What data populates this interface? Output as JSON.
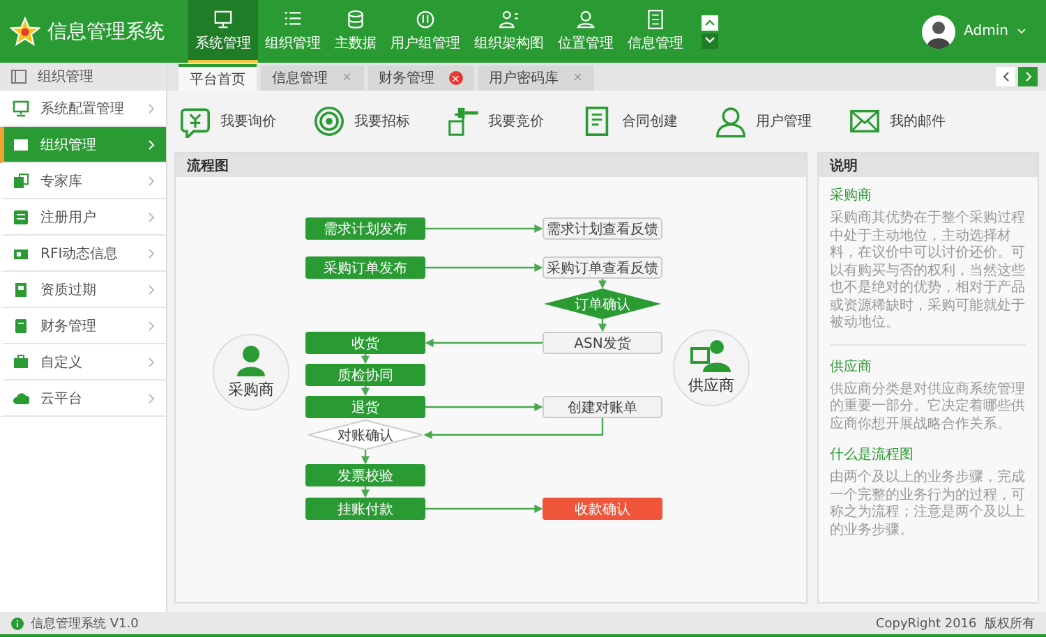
{
  "app": {
    "title": "信息管理系统"
  },
  "top_nav": [
    {
      "label": "系统管理",
      "selected": true
    },
    {
      "label": "组织管理",
      "selected": false
    },
    {
      "label": "主数据",
      "selected": false
    },
    {
      "label": "用户组管理",
      "selected": false
    },
    {
      "label": "组织架构图",
      "selected": false
    },
    {
      "label": "位置管理",
      "selected": false
    },
    {
      "label": "信息管理",
      "selected": false
    }
  ],
  "user": {
    "name": "Admin"
  },
  "sidebar": {
    "title": "组织管理",
    "items": [
      {
        "label": "系统配置管理",
        "selected": false
      },
      {
        "label": "组织管理",
        "selected": true
      },
      {
        "label": "专家库",
        "selected": false
      },
      {
        "label": "注册用户",
        "selected": false
      },
      {
        "label": "RFI动态信息",
        "selected": false
      },
      {
        "label": "资质过期",
        "selected": false
      },
      {
        "label": "财务管理",
        "selected": false
      },
      {
        "label": "自定义",
        "selected": false
      },
      {
        "label": "云平台",
        "selected": false
      }
    ]
  },
  "tabs": [
    {
      "label": "平台首页",
      "selected": true
    },
    {
      "label": "信息管理",
      "selected": false,
      "close": "×",
      "close_hover": false
    },
    {
      "label": "财务管理",
      "selected": false,
      "close": "×",
      "close_hover": true
    },
    {
      "label": "用户密码库",
      "selected": false,
      "close": "×",
      "close_hover": false
    }
  ],
  "shortcuts": [
    {
      "label": "我要询价"
    },
    {
      "label": "我要招标"
    },
    {
      "label": "我要竞价"
    },
    {
      "label": "合同创建"
    },
    {
      "label": "用户管理"
    },
    {
      "label": "我的邮件"
    }
  ],
  "flowchart": {
    "title": "流程图",
    "actors": [
      {
        "label": "采购商"
      },
      {
        "label": "供应商"
      }
    ],
    "nodes": [
      {
        "text": "需求计划发布",
        "kind": "step"
      },
      {
        "text": "需求计划查看反馈",
        "kind": "note"
      },
      {
        "text": "采购订单发布",
        "kind": "step"
      },
      {
        "text": "采购订单查看反馈",
        "kind": "note"
      },
      {
        "text": "订单确认",
        "kind": "decision"
      },
      {
        "text": "收货",
        "kind": "step"
      },
      {
        "text": "ASN发货",
        "kind": "note"
      },
      {
        "text": "质检协同",
        "kind": "step"
      },
      {
        "text": "退货",
        "kind": "step"
      },
      {
        "text": "创建对账单",
        "kind": "note"
      },
      {
        "text": "对账确认",
        "kind": "check"
      },
      {
        "text": "发票校验",
        "kind": "step"
      },
      {
        "text": "挂账付款",
        "kind": "step"
      },
      {
        "text": "收款确认",
        "kind": "alert"
      }
    ]
  },
  "info": {
    "title": "说明",
    "sections": [
      {
        "heading": "采购商",
        "text": "采购商其优势在于整个采购过程中处于主动地位，主动选择材料，在议价中可以讨价还价。可以有购买与否的权利，当然这些也不是绝对的优势，相对于产品或资源稀缺时，采购可能就处于被动地位。"
      },
      {
        "heading": "供应商",
        "text": "供应商分类是对供应商系统管理的重要一部分。它决定着哪些供应商你想开展战略合作关系。"
      },
      {
        "heading": "什么是流程图",
        "text": "由两个及以上的业务步骤，完成一个完整的业务行为的过程，可称之为流程；注意是两个及以上的业务步骤。"
      }
    ]
  },
  "status_bar": {
    "version": "信息管理系统 V1.0",
    "copyright": "CopyRight 2016  版权所有"
  }
}
